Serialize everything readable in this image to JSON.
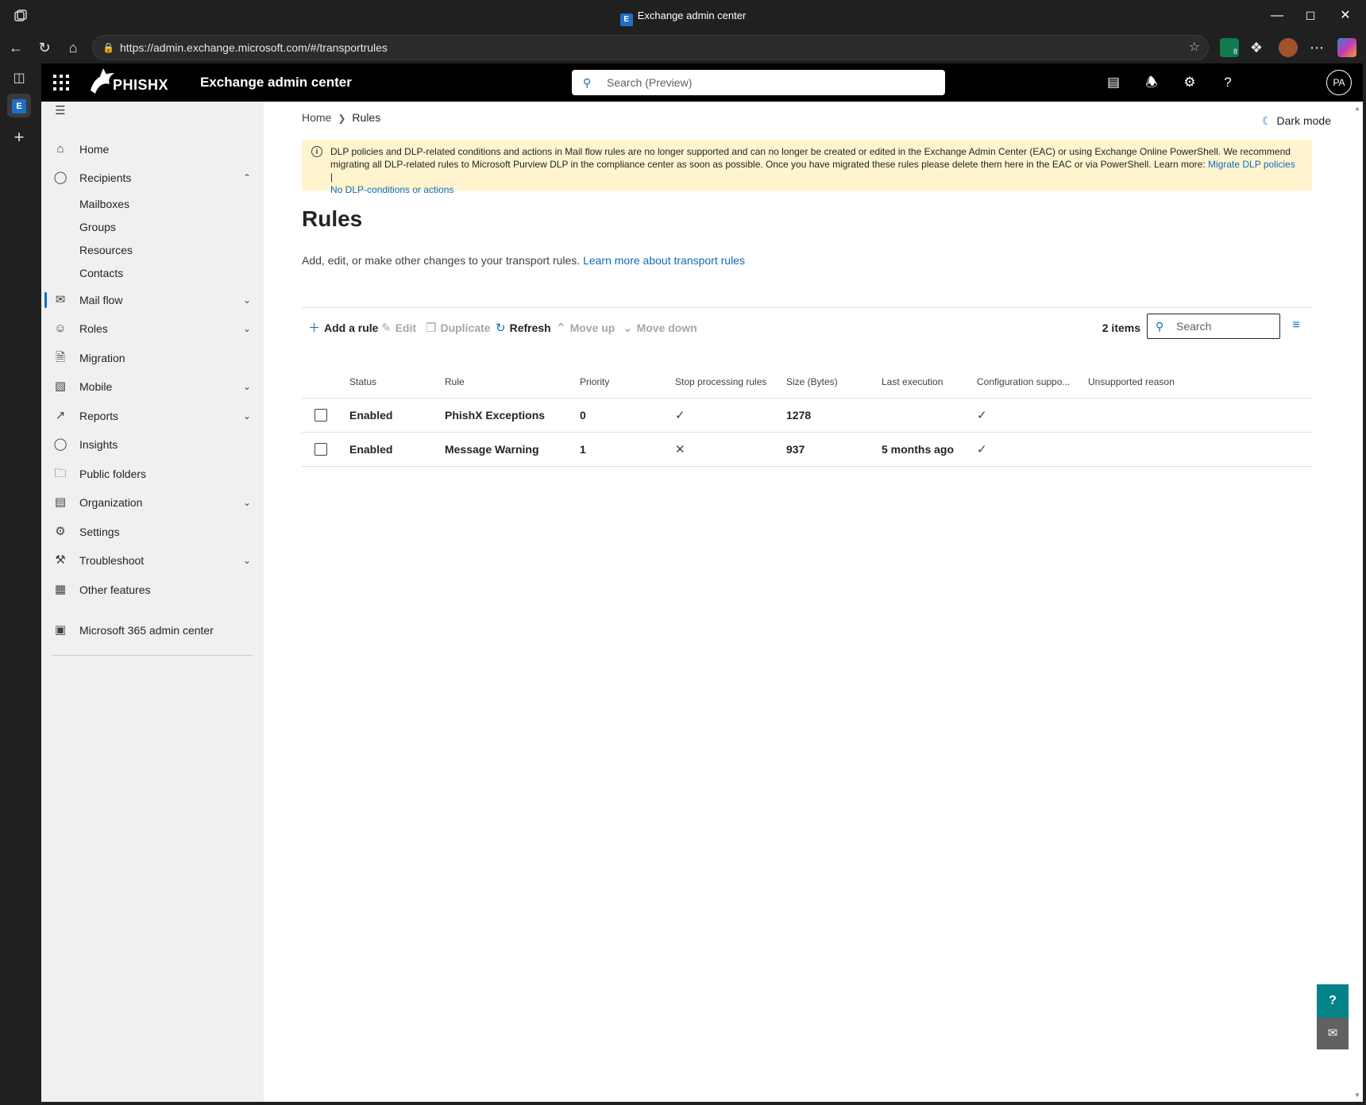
{
  "window": {
    "title": "Exchange admin center",
    "tab_badge": "E"
  },
  "browser": {
    "url": "https://admin.exchange.microsoft.com/#/transportrules",
    "extension_badge": "8"
  },
  "header": {
    "logo_text": "PHISHX",
    "app_title": "Exchange admin center",
    "search_placeholder": "Search (Preview)",
    "avatar_initials": "PA"
  },
  "sidebar": {
    "items": [
      {
        "label": "Home",
        "icon": "home-icon"
      },
      {
        "label": "Recipients",
        "icon": "person-icon",
        "expanded": true
      },
      {
        "label": "Mail flow",
        "icon": "mail-icon",
        "selected": true
      },
      {
        "label": "Roles",
        "icon": "person-key-icon"
      },
      {
        "label": "Migration",
        "icon": "document-arrow-icon"
      },
      {
        "label": "Mobile",
        "icon": "phone-chart-icon"
      },
      {
        "label": "Reports",
        "icon": "chart-line-icon"
      },
      {
        "label": "Insights",
        "icon": "lightbulb-icon"
      },
      {
        "label": "Public folders",
        "icon": "folder-icon"
      },
      {
        "label": "Organization",
        "icon": "org-chart-icon"
      },
      {
        "label": "Settings",
        "icon": "gear-icon"
      },
      {
        "label": "Troubleshoot",
        "icon": "wrench-icon"
      },
      {
        "label": "Other features",
        "icon": "grid-icon"
      }
    ],
    "recipients_sub": [
      "Mailboxes",
      "Groups",
      "Resources",
      "Contacts"
    ],
    "footer_item": "Microsoft 365 admin center"
  },
  "breadcrumb": {
    "home": "Home",
    "current": "Rules"
  },
  "dark_mode_label": "Dark mode",
  "banner": {
    "text": "DLP policies and DLP-related conditions and actions in Mail flow rules are no longer supported and can no longer be created or edited in the Exchange Admin Center (EAC) or using Exchange Online PowerShell. We recommend migrating all DLP-related rules to Microsoft Purview DLP in the compliance center as soon as possible. Once you have migrated these rules please delete them here in the EAC or via PowerShell. Learn more: ",
    "link1": "Migrate DLP policies",
    "separator": " | ",
    "link2": "No DLP-conditions or actions"
  },
  "page": {
    "title": "Rules",
    "description": "Add, edit, or make other changes to your transport rules. ",
    "description_link": "Learn more about transport rules"
  },
  "commands": {
    "add": "Add a rule",
    "edit": "Edit",
    "duplicate": "Duplicate",
    "refresh": "Refresh",
    "move_up": "Move up",
    "move_down": "Move down",
    "item_count": "2 items",
    "search_placeholder": "Search"
  },
  "table": {
    "columns": [
      "Status",
      "Rule",
      "Priority",
      "Stop processing rules",
      "Size (Bytes)",
      "Last execution",
      "Configuration suppo...",
      "Unsupported reason"
    ],
    "rows": [
      {
        "status": "Enabled",
        "rule": "PhishX Exceptions",
        "priority": "0",
        "stop_processing": "✓",
        "size": "1278",
        "last_execution": "",
        "config_supported": "✓",
        "unsupported_reason": ""
      },
      {
        "status": "Enabled",
        "rule": "Message Warning",
        "priority": "1",
        "stop_processing": "✕",
        "size": "937",
        "last_execution": "5 months ago",
        "config_supported": "✓",
        "unsupported_reason": ""
      }
    ]
  },
  "colors": {
    "accent": "#0f6cbd",
    "banner_bg": "#fff4ce",
    "nav_bg": "#f0f0f0",
    "header_bg": "#000000"
  }
}
